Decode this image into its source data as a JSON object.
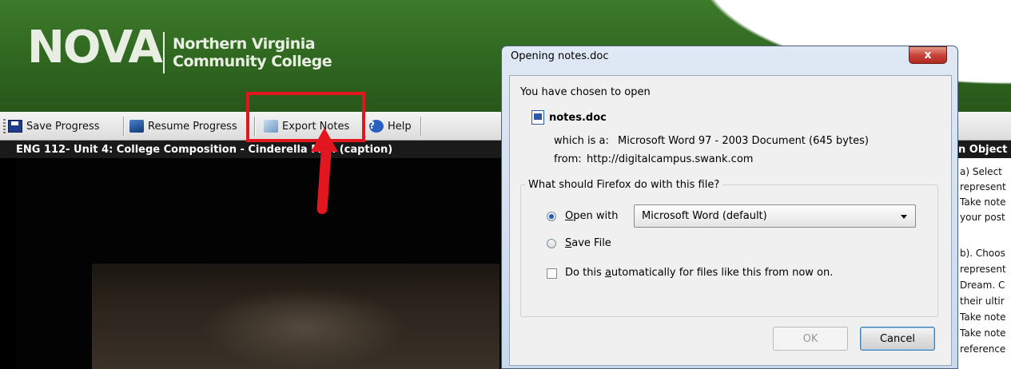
{
  "header": {
    "logo_text": "NOVA",
    "college_line1": "Northern Virginia",
    "college_line2": "Community College"
  },
  "toolbar": {
    "save_label": "Save Progress",
    "resume_label": "Resume Progress",
    "export_label": "Export Notes",
    "help_label": "Help"
  },
  "video": {
    "title": "ENG 112- Unit 4: College Composition - Cinderella Man (caption)"
  },
  "right_panel": {
    "header": "n Object",
    "lines": [
      "a) Select",
      "represent",
      "Take note",
      "your post",
      "b). Choos",
      "represent",
      "Dream. C",
      "their ultir",
      "Take note",
      "Take note",
      "reference"
    ]
  },
  "dialog": {
    "title": "Opening notes.doc",
    "close_label": "x",
    "intro": "You have chosen to open",
    "filename": "notes.doc",
    "which_is_label": "which is a:",
    "which_is_value": "Microsoft Word 97 - 2003 Document (645 bytes)",
    "from_label": "from:",
    "from_value": "http://digitalcampus.swank.com",
    "group_label": "What should Firefox do with this file?",
    "open_with_prefix": "O",
    "open_with_rest": "pen with",
    "open_with_selected": true,
    "app_select_value": "Microsoft Word (default)",
    "save_file_prefix": "S",
    "save_file_rest": "ave File",
    "auto_text_before": "Do this ",
    "auto_text_key": "a",
    "auto_text_after": "utomatically for files like this from now on.",
    "auto_checked": false,
    "ok_label": "OK",
    "cancel_label": "Cancel"
  },
  "colors": {
    "header_green": "#2f6620",
    "annotation_red": "#e1161f",
    "dialog_frame": "#c8d9ee"
  }
}
